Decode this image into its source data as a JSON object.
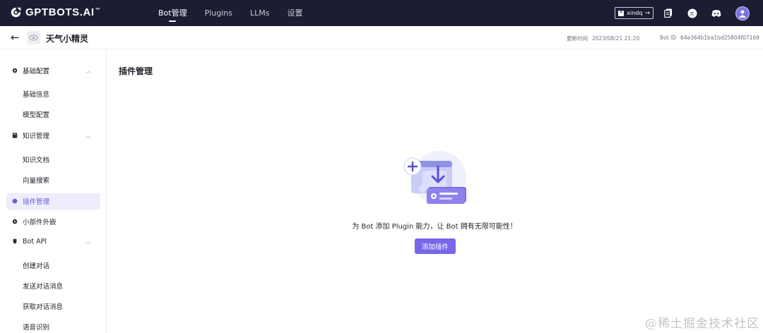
{
  "topnav": {
    "logo_text": "GPTBOTS.AI",
    "logo_tm": "™",
    "tabs": [
      {
        "label": "Bot管理",
        "active": true
      },
      {
        "label": "Plugins",
        "active": false
      },
      {
        "label": "LLMs",
        "active": false
      },
      {
        "label": "设置",
        "active": false
      }
    ],
    "user_chip": {
      "name": "xindq",
      "arrow": "→"
    },
    "icons": [
      "copy-docs-icon",
      "translate-icon",
      "discord-icon",
      "user-avatar-icon"
    ]
  },
  "subheader": {
    "back": "←",
    "bot_name": "天气小精灵",
    "updated_label": "更新时间",
    "updated_value": "2023/08/21 21:20",
    "botid_label": "Bot ID",
    "botid_value": "64e364b1ba1bd25804f07169"
  },
  "sidebar": {
    "groups": [
      {
        "label": "基础配置",
        "icon": "gear-icon",
        "chevron": "^",
        "items": [
          "基础信息",
          "模型配置"
        ]
      },
      {
        "label": "知识管理",
        "icon": "book-icon",
        "chevron": "^",
        "items": [
          "知识文档",
          "向量搜索"
        ]
      },
      {
        "label": "插件管理",
        "icon": "plugin-icon",
        "active": true
      },
      {
        "label": "小部件外嵌",
        "icon": "widget-icon"
      },
      {
        "label": "Bot API",
        "icon": "api-icon",
        "chevron": "^",
        "items": [
          "创建对话",
          "发送对话消息",
          "获取对话消息",
          "语音识别"
        ]
      }
    ]
  },
  "main": {
    "title": "插件管理",
    "empty_text": "为 Bot 添加 Plugin 能力，让 Bot 拥有无限可能性！",
    "add_button": "添加插件"
  },
  "watermark": "@稀土掘金技术社区",
  "colors": {
    "nav_bg": "#1b1d32",
    "accent": "#7767e8",
    "active_bg": "#eeedfb"
  }
}
